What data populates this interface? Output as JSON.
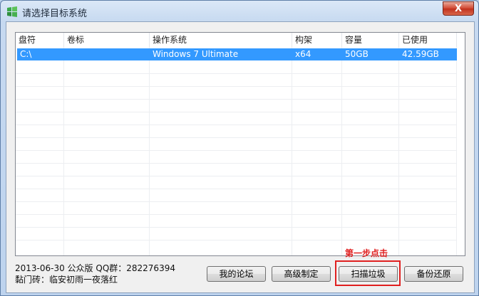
{
  "window": {
    "title": "请选择目标系统",
    "close_label": "X"
  },
  "listview": {
    "columns": [
      "盘符",
      "卷标",
      "操作系统",
      "构架",
      "容量",
      "已使用"
    ],
    "rows": [
      [
        "C:\\",
        "",
        "Windows 7 Ultimate",
        "x64",
        "50GB",
        "42.59GB"
      ]
    ]
  },
  "info": {
    "line1": "2013-06-30 公众版 QQ群：282276394",
    "line2": "黏门砖：临安初雨一夜落红"
  },
  "buttons": {
    "forum": "我的论坛",
    "advanced": "高级制定",
    "scan": "扫描垃圾",
    "backup": "备份还原"
  },
  "annotation": "第一步点击",
  "colors": {
    "selection": "#3399ff",
    "highlight": "#e02020"
  }
}
